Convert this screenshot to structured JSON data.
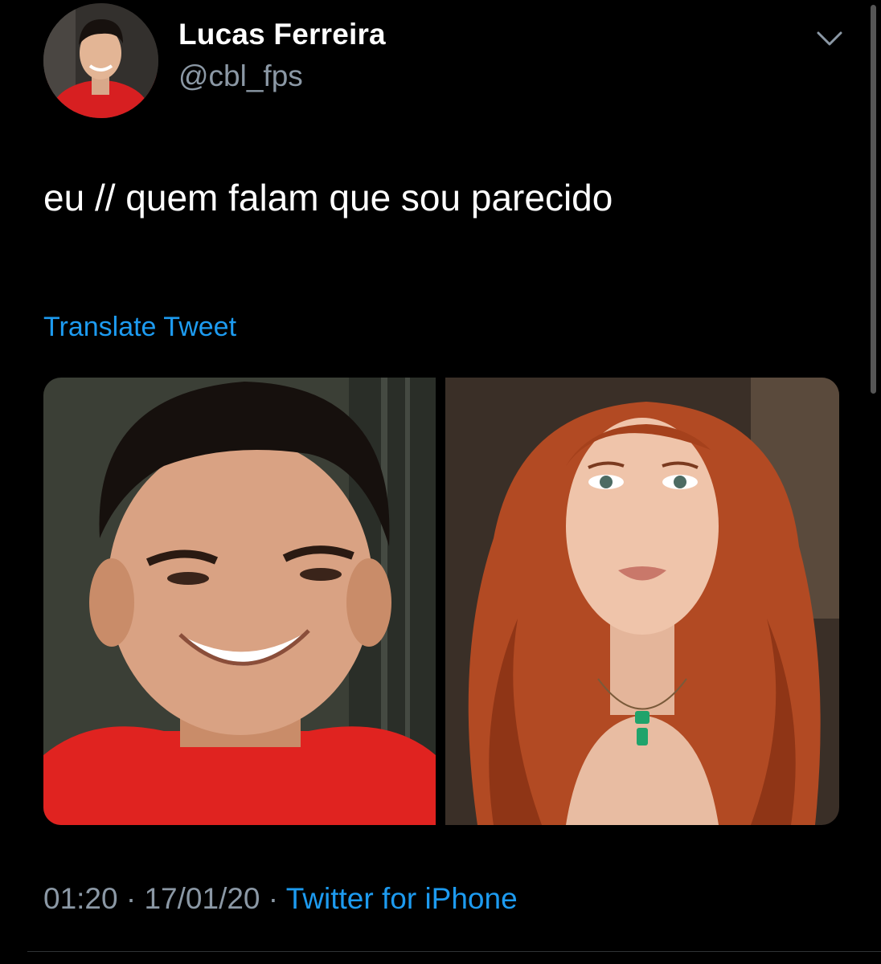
{
  "tweet": {
    "author_name": "Lucas Ferreira",
    "author_handle": "@cbl_fps",
    "text": "eu // quem falam que sou parecido",
    "translate_label": "Translate Tweet",
    "time": "01:20",
    "separator": "·",
    "date": "17/01/20",
    "source": "Twitter for iPhone"
  },
  "icons": {
    "menu": "chevron-down-icon"
  },
  "colors": {
    "background": "#000000",
    "primary_text": "#ffffff",
    "secondary_text": "#8b98a5",
    "link": "#1d9bf0"
  }
}
